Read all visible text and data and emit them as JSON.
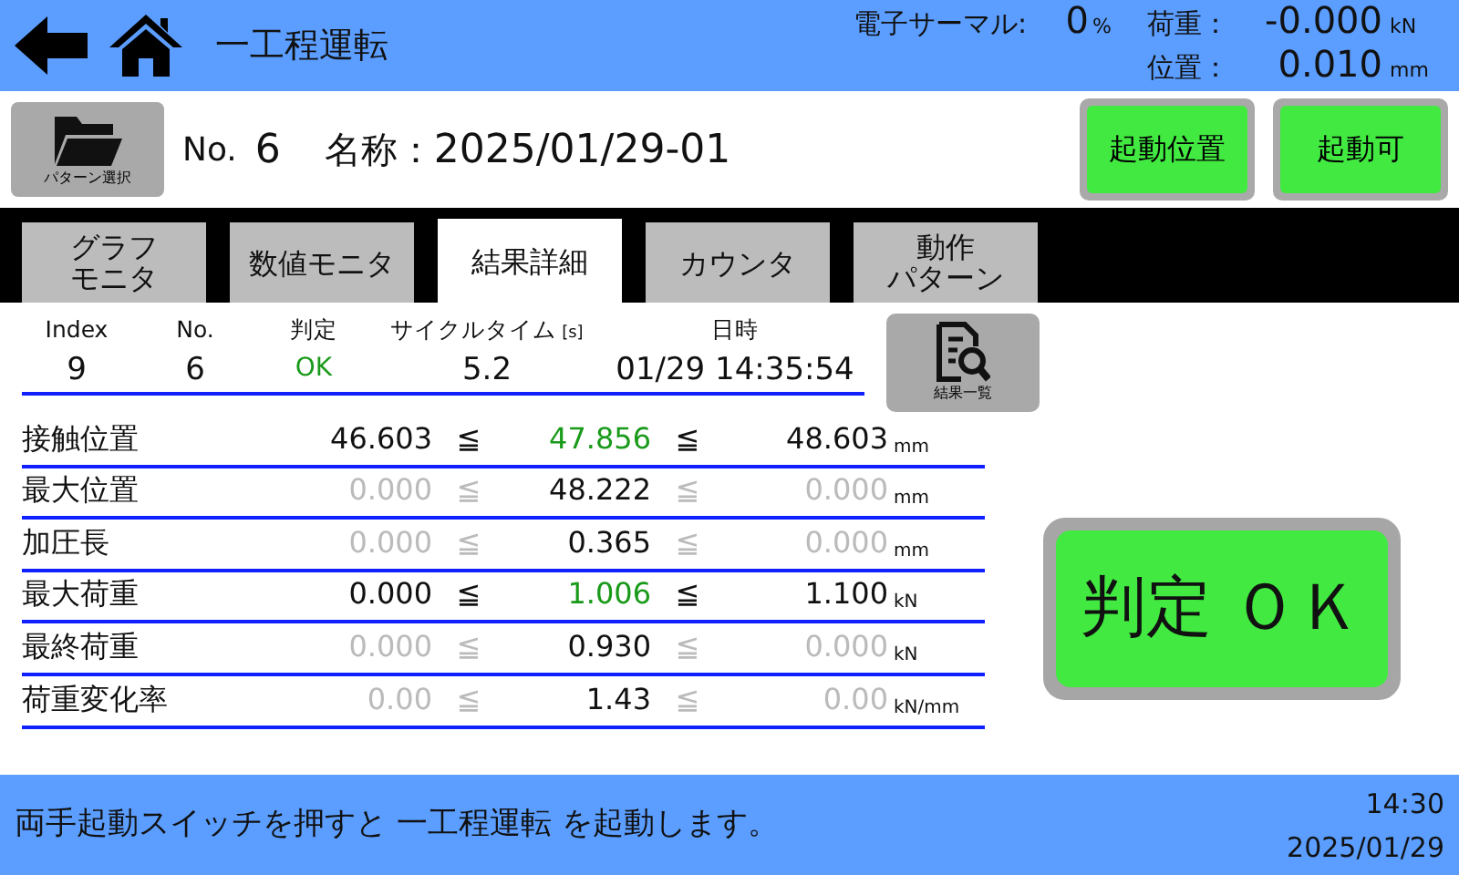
{
  "header": {
    "title": "一工程運転",
    "thermal_label": "電子サーマル:",
    "thermal_value": "0",
    "thermal_unit": "%",
    "load_label": "荷重：",
    "load_value": "-0.000",
    "load_unit": "kN",
    "position_label": "位置：",
    "position_value": "0.010",
    "position_unit": "mm"
  },
  "toolbar": {
    "pattern_button": "パターン選択",
    "no_label": "No.",
    "no_value": "6",
    "name_label": "名称：",
    "name_value": "2025/01/29-01",
    "buttons": [
      {
        "label": "起動位置",
        "on": true
      },
      {
        "label": "起動可",
        "on": true
      }
    ]
  },
  "tabs": [
    {
      "lines": [
        "グラフ",
        "モニタ"
      ],
      "selected": false
    },
    {
      "lines": [
        "数値モニタ"
      ],
      "selected": false
    },
    {
      "lines": [
        "結果詳細"
      ],
      "selected": true
    },
    {
      "lines": [
        "カウンタ"
      ],
      "selected": false
    },
    {
      "lines": [
        "動作",
        "パターン"
      ],
      "selected": false
    }
  ],
  "summary": {
    "columns": [
      {
        "header": "Index",
        "value": "9",
        "ok": false
      },
      {
        "header": "No.",
        "value": "6",
        "ok": false
      },
      {
        "header": "判定",
        "value": "OK",
        "ok": true
      },
      {
        "header": "サイクルタイム",
        "unit": "[s]",
        "value": "5.2",
        "ok": false
      },
      {
        "header": "日時",
        "value": "01/29 14:35:54",
        "ok": false
      }
    ],
    "list_button": "結果一覧"
  },
  "results": [
    {
      "label": "接触位置",
      "lower": "46.603",
      "value": "47.856",
      "upper": "48.603",
      "unit": "mm",
      "limits_enabled": true,
      "value_ok": true
    },
    {
      "label": "最大位置",
      "lower": "0.000",
      "value": "48.222",
      "upper": "0.000",
      "unit": "mm",
      "limits_enabled": false,
      "value_ok": false
    },
    {
      "label": "加圧長",
      "lower": "0.000",
      "value": "0.365",
      "upper": "0.000",
      "unit": "mm",
      "limits_enabled": false,
      "value_ok": false
    },
    {
      "label": "最大荷重",
      "lower": "0.000",
      "value": "1.006",
      "upper": "1.100",
      "unit": "kN",
      "limits_enabled": true,
      "value_ok": true
    },
    {
      "label": "最終荷重",
      "lower": "0.000",
      "value": "0.930",
      "upper": "0.000",
      "unit": "kN",
      "limits_enabled": false,
      "value_ok": false
    },
    {
      "label": "荷重変化率",
      "lower": "0.00",
      "value": "1.43",
      "upper": "0.00",
      "unit": "kN/mm",
      "limits_enabled": false,
      "value_ok": false
    }
  ],
  "le_sign": "≦",
  "judgement": {
    "text": "判定 ＯＫ",
    "ok": true
  },
  "status_bar": {
    "message": "両手起動スイッチを押すと 一工程運転 を起動します。",
    "time": "14:30",
    "date": "2025/01/29"
  }
}
